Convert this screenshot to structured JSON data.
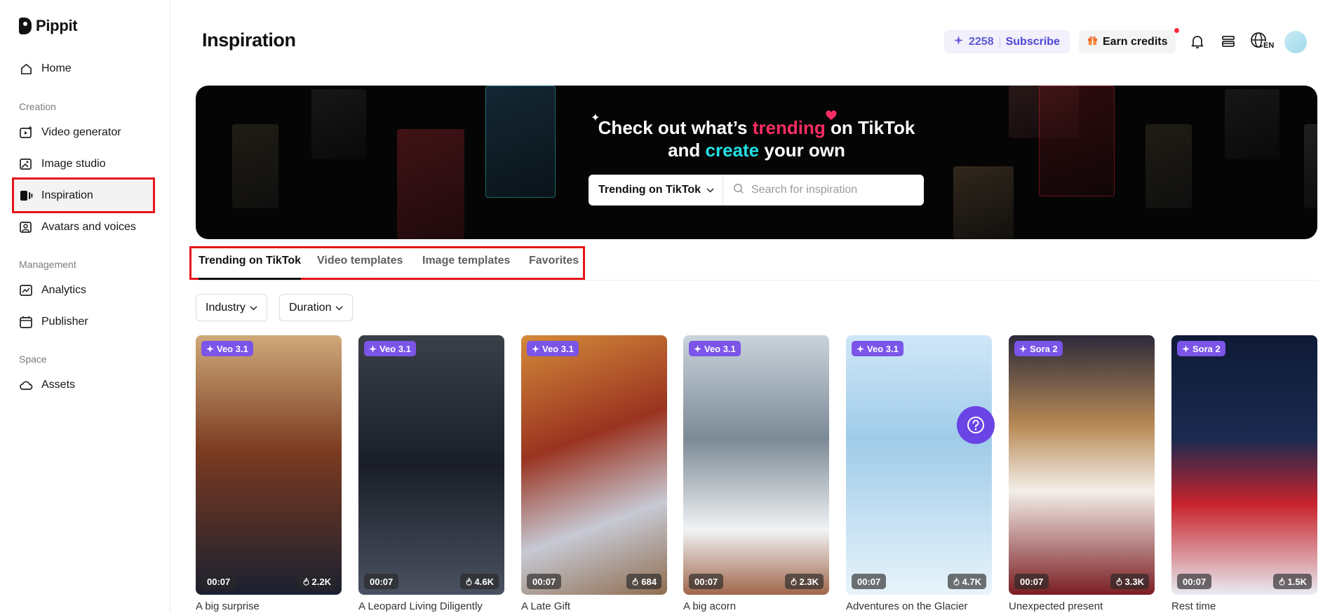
{
  "brand": {
    "name": "Pippit"
  },
  "sidebar": {
    "home": "Home",
    "sections": {
      "creation": "Creation",
      "management": "Management",
      "space": "Space"
    },
    "creation_items": [
      "Video generator",
      "Image studio",
      "Inspiration",
      "Avatars and voices"
    ],
    "management_items": [
      "Analytics",
      "Publisher"
    ],
    "space_items": [
      "Assets"
    ],
    "active_item": "Inspiration"
  },
  "header": {
    "title": "Inspiration",
    "credits": "2258",
    "subscribe_label": "Subscribe",
    "earn_label": "Earn credits",
    "language_code": "EN"
  },
  "banner": {
    "line1_prefix": "Check out what’s ",
    "line1_highlight": "trending",
    "line1_suffix": " on TikTok",
    "line2_prefix": "and ",
    "line2_highlight": "create",
    "line2_suffix": " your own",
    "select_value": "Trending on TikTok",
    "search_placeholder": "Search for inspiration"
  },
  "tabs": [
    "Trending on TikTok",
    "Video templates",
    "Image templates",
    "Favorites"
  ],
  "active_tab": "Trending on TikTok",
  "filters": [
    "Industry",
    "Duration"
  ],
  "cards": [
    {
      "badge": "Veo 3.1",
      "duration": "00:07",
      "views": "2.2K",
      "title": "A big surprise"
    },
    {
      "badge": "Veo 3.1",
      "duration": "00:07",
      "views": "4.6K",
      "title": "A Leopard Living Diligently"
    },
    {
      "badge": "Veo 3.1",
      "duration": "00:07",
      "views": "684",
      "title": "A Late Gift"
    },
    {
      "badge": "Veo 3.1",
      "duration": "00:07",
      "views": "2.3K",
      "title": "A big acorn"
    },
    {
      "badge": "Veo 3.1",
      "duration": "00:07",
      "views": "4.7K",
      "title": "Adventures on the Glacier"
    },
    {
      "badge": "Sora 2",
      "duration": "00:07",
      "views": "3.3K",
      "title": "Unexpected present"
    },
    {
      "badge": "Sora 2",
      "duration": "00:07",
      "views": "1.5K",
      "title": "Rest time"
    }
  ],
  "colors": {
    "accent": "#5f58d6",
    "highlight_box": "#e5151c",
    "trending_pink": "#ff2d63",
    "create_cyan": "#22e0e3",
    "badge_purple": "#7a55e8"
  }
}
